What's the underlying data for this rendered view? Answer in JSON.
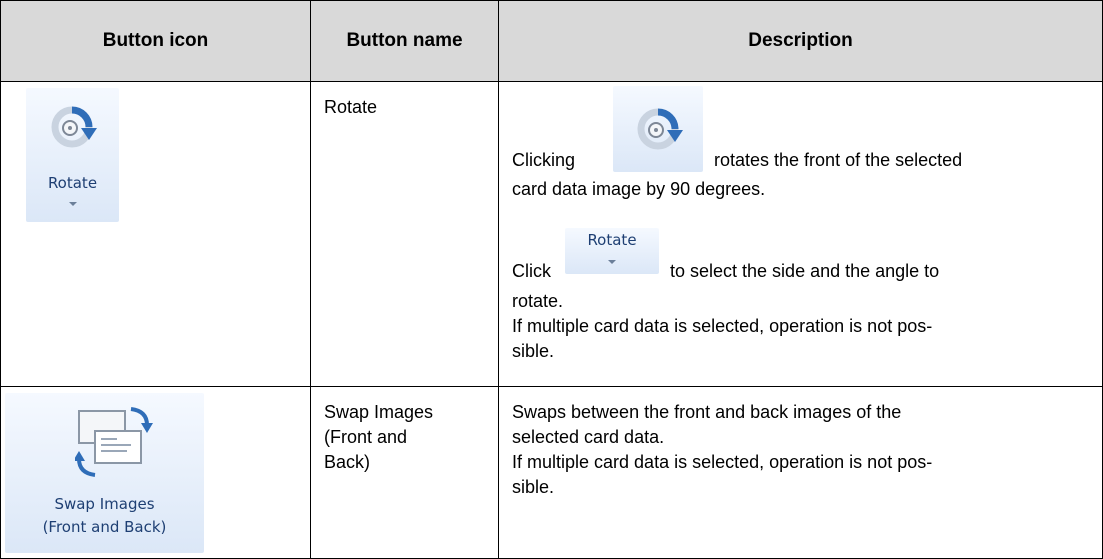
{
  "headers": [
    "Button icon",
    "Button name",
    "Description"
  ],
  "rows": [
    {
      "icon_label": "Rotate",
      "icon_name": "rotate-icon",
      "name": "Rotate",
      "desc": {
        "p1_before": "Clicking",
        "p1_after": "rotates the front of the selected",
        "p1_line2": "card data image by 90 degrees.",
        "p2_before": "Click",
        "p2_after": "to select the side and the angle to",
        "p2_line2": "rotate.",
        "p3_line1": "If multiple card data is selected, operation is not pos-",
        "p3_line2": "sible."
      }
    },
    {
      "icon_label_line1": "Swap Images",
      "icon_label_line2": "(Front and Back)",
      "icon_name": "swap-images-icon",
      "name_line1": "Swap Images",
      "name_line2": "(Front and",
      "name_line3": "Back)",
      "desc": {
        "line1": "Swaps between the front and back images of the",
        "line2": "selected card data.",
        "line3": "If multiple card data is selected, operation is not pos-",
        "line4": "sible."
      }
    }
  ],
  "colors": {
    "header_bg": "#d9d9d9",
    "ribbon_text": "#1e3f73",
    "icon_blue": "#2f6db8"
  }
}
